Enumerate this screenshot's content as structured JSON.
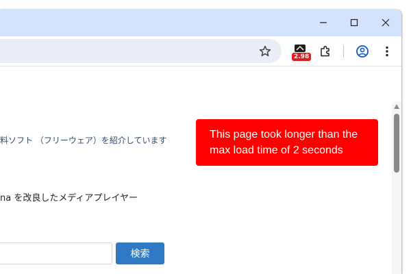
{
  "browser": {
    "extension_badge": "2.98"
  },
  "content": {
    "line1": "料ソフト （フリーウェア）を紹介しています",
    "line2": "na を改良したメディアプレイヤー",
    "search_value": "",
    "search_button": "検索"
  },
  "toast": {
    "message": "This page took longer than the max load time of 2 seconds"
  },
  "colors": {
    "titlebar": "#d3e3fd",
    "omnibox": "#e9eef6",
    "toast": "#ff0000",
    "search_button": "#2f79c5",
    "badge": "#e02020"
  },
  "icons": [
    "minimize-icon",
    "maximize-icon",
    "close-icon",
    "star-icon",
    "extension-icon",
    "puzzle-icon",
    "profile-icon",
    "kebab-menu-icon"
  ]
}
